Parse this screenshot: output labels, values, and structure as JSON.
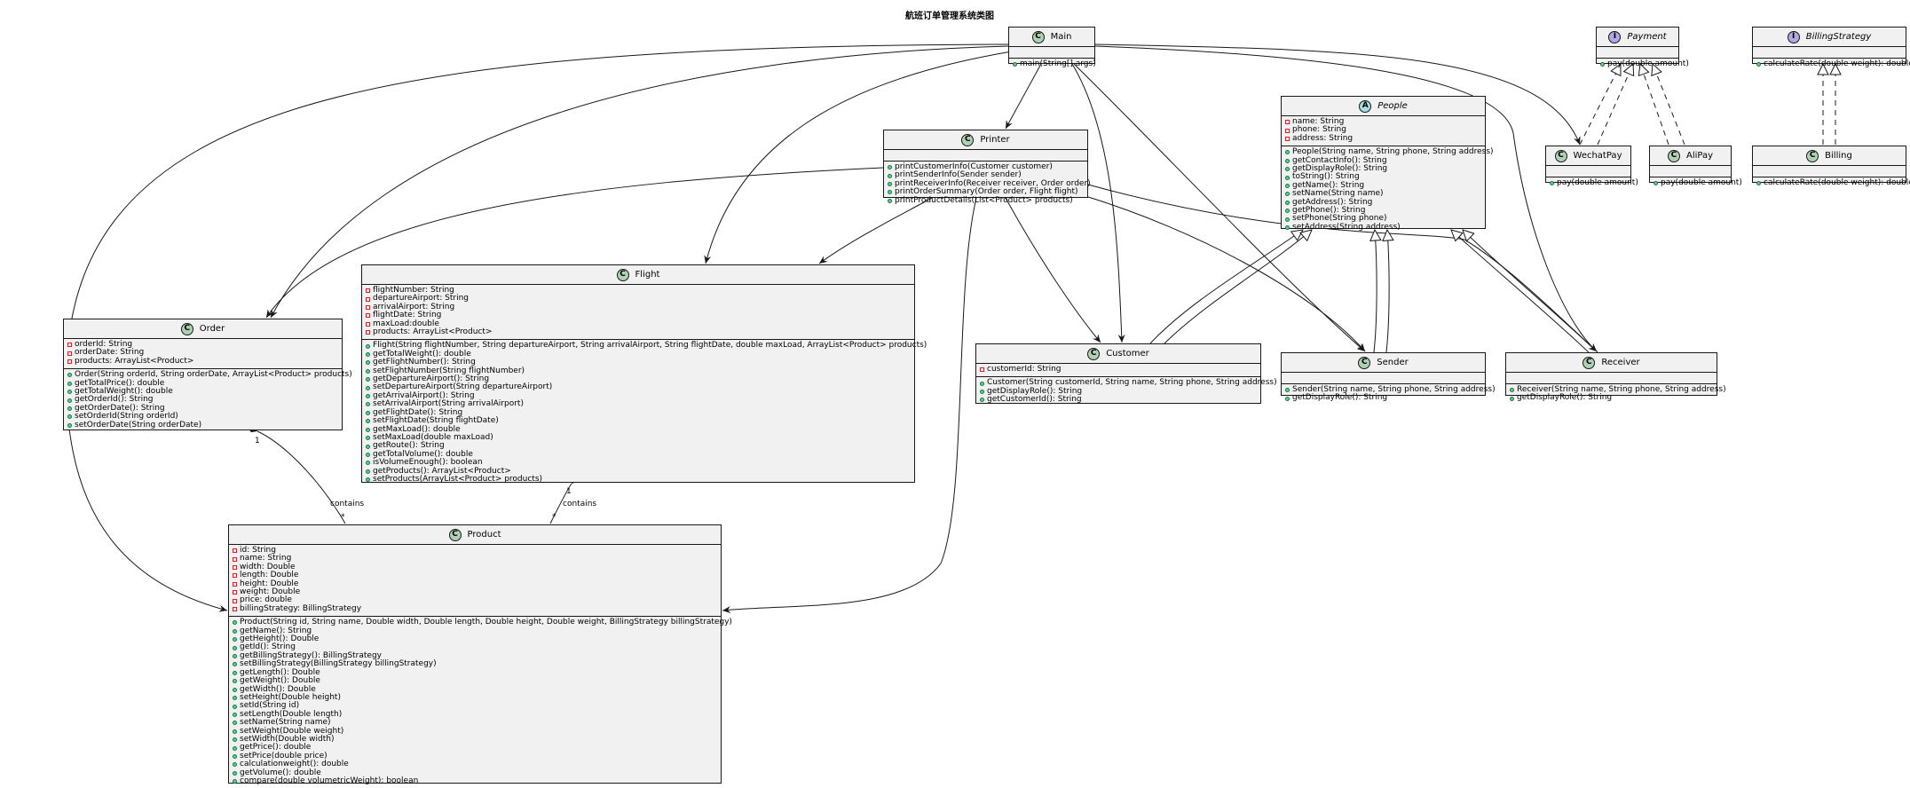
{
  "diagram": {
    "title": "航班订单管理系统类图",
    "classes": [
      {
        "id": "Main",
        "name": "Main",
        "kind": "C",
        "italic": false,
        "fields": [],
        "methods": [
          {
            "vis": "public",
            "text": "main(String[] args)"
          }
        ]
      },
      {
        "id": "Printer",
        "name": "Printer",
        "kind": "C",
        "italic": false,
        "fields": [],
        "methods": [
          {
            "vis": "public",
            "text": "printCustomerInfo(Customer customer)"
          },
          {
            "vis": "public",
            "text": "printSenderInfo(Sender sender)"
          },
          {
            "vis": "public",
            "text": "printReceiverInfo(Receiver receiver, Order order)"
          },
          {
            "vis": "public",
            "text": "printOrderSummary(Order order, Flight flight)"
          },
          {
            "vis": "public",
            "text": "printProductDetails(List<Product> products)"
          }
        ]
      },
      {
        "id": "Payment",
        "name": "Payment",
        "kind": "I",
        "italic": true,
        "fields": [],
        "methods": [
          {
            "vis": "public",
            "text": "pay(double amount)"
          }
        ]
      },
      {
        "id": "BillingStrategy",
        "name": "BillingStrategy",
        "kind": "I",
        "italic": true,
        "fields": [],
        "methods": [
          {
            "vis": "public",
            "text": "calculateRate(double weight): double"
          }
        ]
      },
      {
        "id": "People",
        "name": "People",
        "kind": "A",
        "italic": true,
        "fields": [
          {
            "vis": "private",
            "text": "name: String"
          },
          {
            "vis": "private",
            "text": "phone: String"
          },
          {
            "vis": "private",
            "text": "address: String"
          }
        ],
        "methods": [
          {
            "vis": "public",
            "text": "People(String name, String phone, String address)"
          },
          {
            "vis": "public",
            "text": "getContactInfo(): String"
          },
          {
            "vis": "public",
            "text": "getDisplayRole(): String"
          },
          {
            "vis": "public",
            "text": "toString(): String"
          },
          {
            "vis": "public",
            "text": "getName(): String"
          },
          {
            "vis": "public",
            "text": "setName(String name)"
          },
          {
            "vis": "public",
            "text": "getAddress(): String"
          },
          {
            "vis": "public",
            "text": "getPhone(): String"
          },
          {
            "vis": "public",
            "text": "setPhone(String phone)"
          },
          {
            "vis": "public",
            "text": "setAddress(String address)"
          }
        ]
      },
      {
        "id": "WechatPay",
        "name": "WechatPay",
        "kind": "C",
        "italic": false,
        "fields": [],
        "methods": [
          {
            "vis": "public",
            "text": "pay(double amount)"
          }
        ]
      },
      {
        "id": "AliPay",
        "name": "AliPay",
        "kind": "C",
        "italic": false,
        "fields": [],
        "methods": [
          {
            "vis": "public",
            "text": "pay(double amount)"
          }
        ]
      },
      {
        "id": "Billing",
        "name": "Billing",
        "kind": "C",
        "italic": false,
        "fields": [],
        "methods": [
          {
            "vis": "public",
            "text": "calculateRate(double weight): double"
          }
        ]
      },
      {
        "id": "Flight",
        "name": "Flight",
        "kind": "C",
        "italic": false,
        "fields": [
          {
            "vis": "private",
            "text": "flightNumber: String"
          },
          {
            "vis": "private",
            "text": "departureAirport: String"
          },
          {
            "vis": "private",
            "text": "arrivalAirport: String"
          },
          {
            "vis": "private",
            "text": "flightDate: String"
          },
          {
            "vis": "private",
            "text": "maxLoad:double"
          },
          {
            "vis": "private",
            "text": "products: ArrayList<Product>"
          }
        ],
        "methods": [
          {
            "vis": "public",
            "text": "Flight(String flightNumber, String departureAirport, String arrivalAirport, String flightDate, double maxLoad, ArrayList<Product> products)"
          },
          {
            "vis": "public",
            "text": "getTotalWeight(): double"
          },
          {
            "vis": "public",
            "text": "getFlightNumber(): String"
          },
          {
            "vis": "public",
            "text": "setFlightNumber(String flightNumber)"
          },
          {
            "vis": "public",
            "text": "getDepartureAirport(): String"
          },
          {
            "vis": "public",
            "text": "setDepartureAirport(String departureAirport)"
          },
          {
            "vis": "public",
            "text": "getArrivalAirport(): String"
          },
          {
            "vis": "public",
            "text": "setArrivalAirport(String arrivalAirport)"
          },
          {
            "vis": "public",
            "text": "getFlightDate(): String"
          },
          {
            "vis": "public",
            "text": "setFlightDate(String flightDate)"
          },
          {
            "vis": "public",
            "text": "getMaxLoad(): double"
          },
          {
            "vis": "public",
            "text": "setMaxLoad(double maxLoad)"
          },
          {
            "vis": "public",
            "text": "getRoute(): String"
          },
          {
            "vis": "public",
            "text": "getTotalVolume(): double"
          },
          {
            "vis": "public",
            "text": "isVolumeEnough(): boolean"
          },
          {
            "vis": "public",
            "text": "getProducts(): ArrayList<Product>"
          },
          {
            "vis": "public",
            "text": "setProducts(ArrayList<Product> products)"
          }
        ]
      },
      {
        "id": "Order",
        "name": "Order",
        "kind": "C",
        "italic": false,
        "fields": [
          {
            "vis": "private",
            "text": "orderId: String"
          },
          {
            "vis": "private",
            "text": "orderDate: String"
          },
          {
            "vis": "private",
            "text": "products: ArrayList<Product>"
          }
        ],
        "methods": [
          {
            "vis": "public",
            "text": "Order(String orderId, String orderDate, ArrayList<Product> products)"
          },
          {
            "vis": "public",
            "text": "getTotalPrice(): double"
          },
          {
            "vis": "public",
            "text": "getTotalWeight(): double"
          },
          {
            "vis": "public",
            "text": "getOrderId(): String"
          },
          {
            "vis": "public",
            "text": "getOrderDate(): String"
          },
          {
            "vis": "public",
            "text": "setOrderId(String orderId)"
          },
          {
            "vis": "public",
            "text": "setOrderDate(String orderDate)"
          }
        ]
      },
      {
        "id": "Customer",
        "name": "Customer",
        "kind": "C",
        "italic": false,
        "fields": [
          {
            "vis": "private",
            "text": "customerId: String"
          }
        ],
        "methods": [
          {
            "vis": "public",
            "text": "Customer(String customerId, String name, String phone, String address)"
          },
          {
            "vis": "public",
            "text": "getDisplayRole(): String"
          },
          {
            "vis": "public",
            "text": "getCustomerId(): String"
          }
        ]
      },
      {
        "id": "Sender",
        "name": "Sender",
        "kind": "C",
        "italic": false,
        "fields": [],
        "methods": [
          {
            "vis": "public",
            "text": "Sender(String name, String phone, String address)"
          },
          {
            "vis": "public",
            "text": "getDisplayRole(): String"
          }
        ]
      },
      {
        "id": "Receiver",
        "name": "Receiver",
        "kind": "C",
        "italic": false,
        "fields": [],
        "methods": [
          {
            "vis": "public",
            "text": "Receiver(String name, String phone, String address)"
          },
          {
            "vis": "public",
            "text": "getDisplayRole(): String"
          }
        ]
      },
      {
        "id": "Product",
        "name": "Product",
        "kind": "C",
        "italic": false,
        "fields": [
          {
            "vis": "private",
            "text": "id: String"
          },
          {
            "vis": "private",
            "text": "name: String"
          },
          {
            "vis": "private",
            "text": "width: Double"
          },
          {
            "vis": "private",
            "text": "length: Double"
          },
          {
            "vis": "private",
            "text": "height: Double"
          },
          {
            "vis": "private",
            "text": "weight: Double"
          },
          {
            "vis": "private",
            "text": "price: double"
          },
          {
            "vis": "private",
            "text": "billingStrategy: BillingStrategy"
          }
        ],
        "methods": [
          {
            "vis": "public",
            "text": "Product(String id, String name, Double width, Double length, Double height, Double weight, BillingStrategy billingStrategy)"
          },
          {
            "vis": "public",
            "text": "getName(): String"
          },
          {
            "vis": "public",
            "text": "getHeight(): Double"
          },
          {
            "vis": "public",
            "text": "getId(): String"
          },
          {
            "vis": "public",
            "text": "getBillingStrategy(): BillingStrategy"
          },
          {
            "vis": "public",
            "text": "setBillingStrategy(BillingStrategy billingStrategy)"
          },
          {
            "vis": "public",
            "text": "getLength(): Double"
          },
          {
            "vis": "public",
            "text": "getWeight(): Double"
          },
          {
            "vis": "public",
            "text": "getWidth(): Double"
          },
          {
            "vis": "public",
            "text": "setHeight(Double height)"
          },
          {
            "vis": "public",
            "text": "setId(String id)"
          },
          {
            "vis": "public",
            "text": "setLength(Double length)"
          },
          {
            "vis": "public",
            "text": "setName(String name)"
          },
          {
            "vis": "public",
            "text": "setWeight(Double weight)"
          },
          {
            "vis": "public",
            "text": "setWidth(Double width)"
          },
          {
            "vis": "public",
            "text": "getPrice(): double"
          },
          {
            "vis": "public",
            "text": "setPrice(double price)"
          },
          {
            "vis": "public",
            "text": "calculationweight(): double"
          },
          {
            "vis": "public",
            "text": "getVolume(): double"
          },
          {
            "vis": "public",
            "text": "compare(double volumetricWeight): boolean"
          }
        ]
      }
    ],
    "relations": [
      {
        "from": "Main",
        "to": "Printer",
        "type": "dependency"
      },
      {
        "from": "Main",
        "to": "Order",
        "type": "dependency"
      },
      {
        "from": "Main",
        "to": "Flight",
        "type": "dependency"
      },
      {
        "from": "Main",
        "to": "Product",
        "type": "dependency"
      },
      {
        "from": "Main",
        "to": "Customer",
        "type": "dependency"
      },
      {
        "from": "Main",
        "to": "Sender",
        "type": "dependency"
      },
      {
        "from": "Main",
        "to": "Receiver",
        "type": "dependency"
      },
      {
        "from": "Main",
        "to": "WechatPay",
        "type": "dependency"
      },
      {
        "from": "Printer",
        "to": "Order",
        "type": "dependency"
      },
      {
        "from": "Printer",
        "to": "Flight",
        "type": "dependency"
      },
      {
        "from": "Printer",
        "to": "Product",
        "type": "dependency"
      },
      {
        "from": "Printer",
        "to": "Customer",
        "type": "dependency"
      },
      {
        "from": "Printer",
        "to": "Sender",
        "type": "dependency"
      },
      {
        "from": "Printer",
        "to": "Receiver",
        "type": "dependency"
      },
      {
        "from": "WechatPay",
        "to": "Payment",
        "type": "realization"
      },
      {
        "from": "AliPay",
        "to": "Payment",
        "type": "realization"
      },
      {
        "from": "Billing",
        "to": "BillingStrategy",
        "type": "realization"
      },
      {
        "from": "Customer",
        "to": "People",
        "type": "inheritance"
      },
      {
        "from": "Sender",
        "to": "People",
        "type": "inheritance"
      },
      {
        "from": "Receiver",
        "to": "People",
        "type": "inheritance"
      },
      {
        "from": "Order",
        "to": "Product",
        "type": "composition",
        "label": "contains",
        "mult_whole": "1",
        "mult_part": "*"
      },
      {
        "from": "Flight",
        "to": "Product",
        "type": "composition",
        "label": "contains",
        "mult_whole": "1",
        "mult_part": "*"
      }
    ]
  }
}
